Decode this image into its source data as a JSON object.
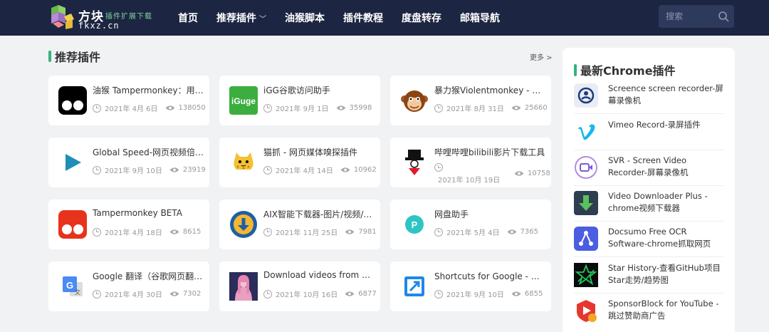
{
  "header": {
    "logo_title": "方块",
    "logo_subtitle": "插件扩展下载",
    "logo_domain": "fkxz.cn",
    "nav": [
      {
        "label": "首页"
      },
      {
        "label": "推荐插件"
      },
      {
        "label": "油猴脚本"
      },
      {
        "label": "插件教程"
      },
      {
        "label": "度盘转存"
      },
      {
        "label": "邮箱导航"
      }
    ],
    "search_placeholder": "搜索"
  },
  "section": {
    "title": "推荐插件",
    "more_label": "更多 >"
  },
  "cards": [
    {
      "title": "油猴 Tampermonkey：用户脚本管理器",
      "date": "2021年 4月 6日",
      "views": "138050",
      "icon": "tampermonkey-icon"
    },
    {
      "title": "iGG谷歌访问助手",
      "date": "2021年 9月 1日",
      "views": "35998",
      "icon": "iguge-icon"
    },
    {
      "title": "暴力猴Violentmonkey - 浏览器脚本管理器",
      "date": "2021年 8月 31日",
      "views": "25660",
      "icon": "violentmonkey-icon"
    },
    {
      "title": "Global Speed-网页视频倍速播放插件",
      "date": "2021年 9月 10日",
      "views": "23919",
      "icon": "global-speed-icon"
    },
    {
      "title": "猫抓 - 网页媒体嗅探插件",
      "date": "2021年 4月 14日",
      "views": "10962",
      "icon": "cat-catch-icon"
    },
    {
      "title": "哔哩哔哩bilibili影片下载工具",
      "date": "2021年 10月 19日",
      "views": "10758",
      "icon": "bilibili-downloader-icon"
    },
    {
      "title": "Tampermonkey BETA",
      "date": "2021年 4月 18日",
      "views": "8615",
      "icon": "tampermonkey-beta-icon"
    },
    {
      "title": "AIX智能下载器-图片/视频/音乐",
      "date": "2021年 11月 25日",
      "views": "7981",
      "icon": "aix-downloader-icon"
    },
    {
      "title": "网盘助手",
      "date": "2021年 5月 4日",
      "views": "7365",
      "icon": "netdisk-helper-icon"
    },
    {
      "title": "Google 翻译（谷歌网页翻译）",
      "date": "2021年 4月 30日",
      "views": "7302",
      "icon": "google-translate-icon"
    },
    {
      "title": "Download videos from OnlyFans",
      "date": "2021年 10月 16日",
      "views": "6877",
      "icon": "video-download-icon"
    },
    {
      "title": "Shortcuts for Google - 谷歌快捷方式",
      "date": "2021年 9月 10日",
      "views": "6855",
      "icon": "shortcuts-google-icon"
    }
  ],
  "panel": {
    "title": "最新Chrome插件",
    "items": [
      {
        "name": "Screence screen recorder-屏幕录像机",
        "icon": "screence-icon"
      },
      {
        "name": "Vimeo Record-录屏插件",
        "icon": "vimeo-icon"
      },
      {
        "name": "SVR - Screen Video Recorder-屏幕录像机",
        "icon": "svr-icon"
      },
      {
        "name": "Video Downloader Plus - chrome视频下载器",
        "icon": "video-downloader-plus-icon"
      },
      {
        "name": "Docsumo Free OCR Software-chrome抓取网页",
        "icon": "docsumo-icon"
      },
      {
        "name": "Star History-查看GitHub项目Star走势/趋势图",
        "icon": "star-history-icon"
      },
      {
        "name": "SponsorBlock for YouTube - 跳过赞助商广告",
        "icon": "sponsorblock-icon"
      }
    ]
  },
  "colors": {
    "header_bg": "#1c2541",
    "accent_green": "#35b37e",
    "page_bg": "#f1f2f4"
  }
}
